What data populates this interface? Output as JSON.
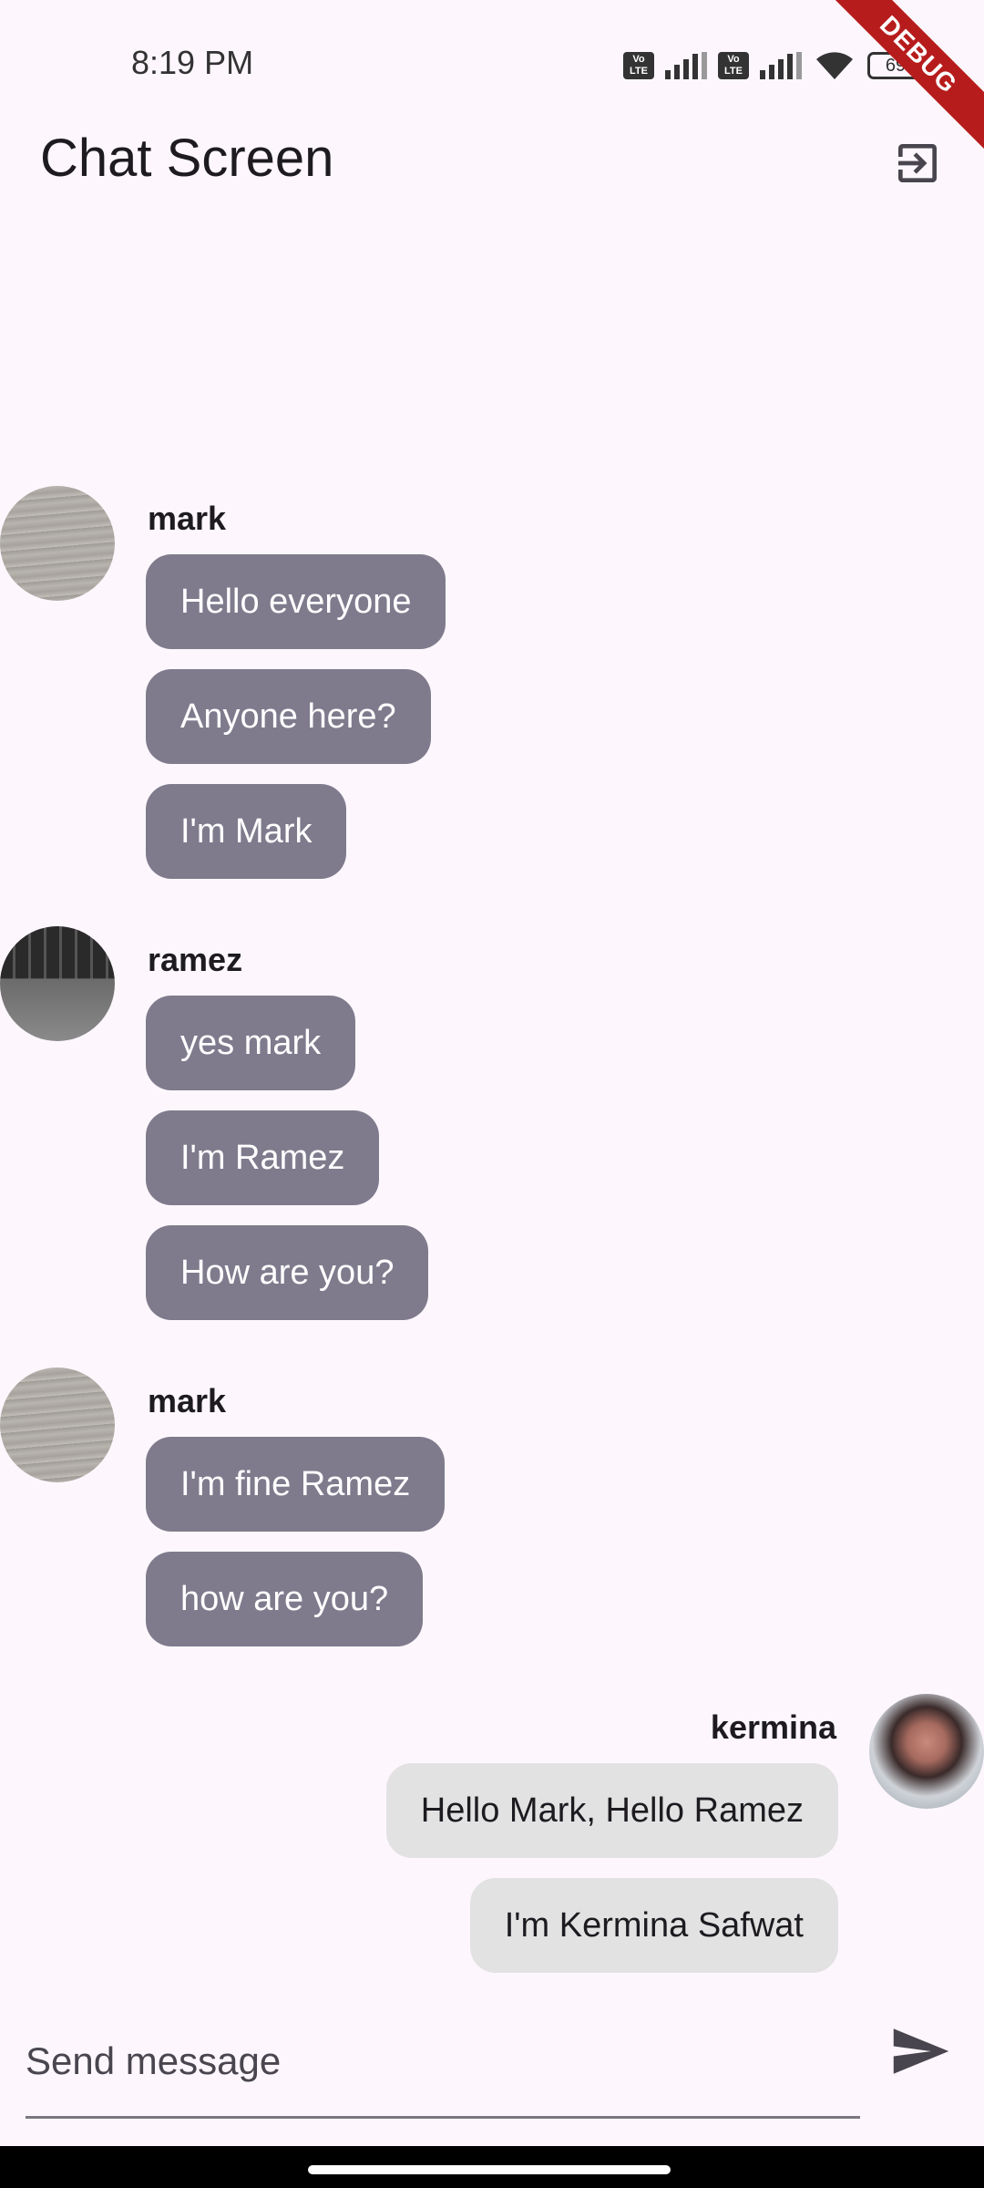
{
  "status_bar": {
    "time": "8:19 PM",
    "battery": "69",
    "volte_label": "Vo\nLTE",
    "icons": [
      "volte-icon",
      "signal-icon",
      "volte-icon",
      "signal-icon",
      "wifi-icon",
      "battery-icon"
    ]
  },
  "debug_banner": "DEBUG",
  "app_bar": {
    "title": "Chat Screen",
    "action_icon": "logout-icon"
  },
  "messages": [
    {
      "sender": "mark",
      "avatar": "wood-texture-avatar",
      "lines": [
        "Hello everyone",
        "Anyone here?",
        "I'm Mark"
      ]
    },
    {
      "sender": "ramez",
      "avatar": "keyboard-photo-avatar",
      "lines": [
        "yes mark",
        "I'm Ramez",
        "How are you?"
      ]
    },
    {
      "sender": "mark",
      "avatar": "wood-texture-avatar",
      "lines": [
        "I'm fine Ramez",
        "how are you?"
      ]
    },
    {
      "sender": "kermina",
      "avatar": "person-photo-avatar",
      "own": true,
      "lines": [
        "Hello Mark, Hello Ramez",
        "I'm Kermina Safwat"
      ]
    }
  ],
  "input": {
    "placeholder": "Send message",
    "value": "",
    "send_icon": "send-icon"
  },
  "colors": {
    "background": "#fdf7fd",
    "incoming_bubble": "#7f7b8d",
    "outgoing_bubble": "#e2e2e2",
    "debug_banner": "#b71c1c"
  }
}
